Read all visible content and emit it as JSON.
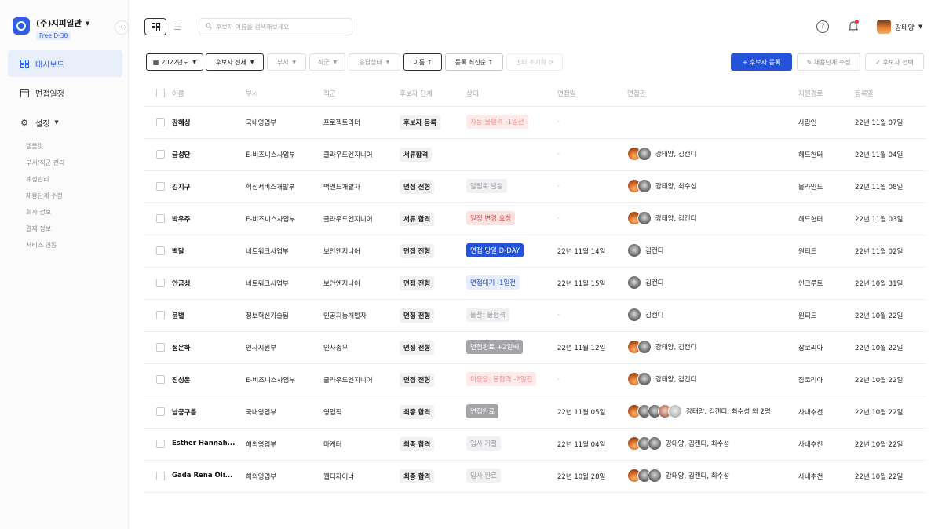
{
  "sidebar": {
    "company": "(주)지피일만",
    "plan_badge": "Free D-30",
    "nav": [
      {
        "label": "대시보드",
        "icon": "grid-icon",
        "active": true
      },
      {
        "label": "면접일정",
        "icon": "calendar-icon",
        "active": false
      },
      {
        "label": "설정",
        "icon": "gear-icon",
        "active": false
      }
    ],
    "sub_items": [
      "템플릿",
      "부서/직군 관리",
      "계정관리",
      "채용단계 수정",
      "회사 정보",
      "결제 정보",
      "서비스 연동"
    ]
  },
  "topbar": {
    "search_placeholder": "후보자 이름을 검색해보세요",
    "user_name": "강태양"
  },
  "filters": {
    "year": "2022년도",
    "candidates_all": "후보자 전체",
    "department": "부서",
    "job": "직군",
    "response_status": "응답상태",
    "name_sort": "이름 ↑",
    "registered_sort": "등록 최신순 ↑",
    "reset": "필터 초기화 ⟳"
  },
  "actions": {
    "add_candidate": "+ 후보자 등록",
    "edit_stage": "✎ 채용단계 수정",
    "select_candidate": "✓ 후보자 선택"
  },
  "table": {
    "columns": [
      "이름",
      "부서",
      "직군",
      "후보자 단계",
      "상태",
      "면접일",
      "면접관",
      "지원경로",
      "등록일"
    ],
    "rows": [
      {
        "name": "강혜성",
        "dept": "국내영업부",
        "job": "프로젝트리더",
        "stage": "후보자 등록",
        "status": "자동 불합격 -1일전",
        "status_style": "b-red",
        "date": "-",
        "avatars": [],
        "interviewers": "",
        "source": "사람인",
        "registered": "22년 11월 07일"
      },
      {
        "name": "금성단",
        "dept": "E-비즈니스사업부",
        "job": "클라우드엔지니어",
        "stage": "서류합격",
        "status": "",
        "status_style": "",
        "date": "-",
        "avatars": [
          "o",
          "g"
        ],
        "interviewers": "강태양, 김캔디",
        "source": "헤드헌터",
        "registered": "22년 11월 04일"
      },
      {
        "name": "김지구",
        "dept": "혁신서비스개발부",
        "job": "백엔드개발자",
        "stage": "면접 전형",
        "status": "알림톡 발송",
        "status_style": "b-gray",
        "date": "-",
        "avatars": [
          "o",
          "g"
        ],
        "interviewers": "강태양, 최수성",
        "source": "블라인드",
        "registered": "22년 11월 08일"
      },
      {
        "name": "박우주",
        "dept": "E-비즈니스사업부",
        "job": "클라우드엔지니어",
        "stage": "서류 합격",
        "status": "일정 변경 요청",
        "status_style": "b-red-strong",
        "date": "-",
        "avatars": [
          "o",
          "g"
        ],
        "interviewers": "강태양, 김캔디",
        "source": "헤드헌터",
        "registered": "22년 11월 03일"
      },
      {
        "name": "백달",
        "dept": "네트워크사업부",
        "job": "보안엔지니어",
        "stage": "면접 전형",
        "status": "면접 당일 D-DAY",
        "status_style": "b-blue",
        "date": "22년 11월 14일",
        "avatars": [
          "g"
        ],
        "interviewers": "김캔디",
        "source": "원티드",
        "registered": "22년 11월 02일"
      },
      {
        "name": "안금성",
        "dept": "네트워크사업부",
        "job": "보안엔지니어",
        "stage": "면접 전형",
        "status": "면접대기 -1일전",
        "status_style": "b-lightblue",
        "date": "22년 11월 15일",
        "avatars": [
          "g"
        ],
        "interviewers": "김캔디",
        "source": "인크루트",
        "registered": "22년 10월 31일"
      },
      {
        "name": "윤별",
        "dept": "정보혁신기술팀",
        "job": "인공지능개발자",
        "stage": "면접 전형",
        "status": "불참: 불합격",
        "status_style": "b-gray",
        "date": "-",
        "avatars": [
          "g"
        ],
        "interviewers": "김캔디",
        "source": "원티드",
        "registered": "22년 10월 22일"
      },
      {
        "name": "정은하",
        "dept": "인사지원부",
        "job": "인사총무",
        "stage": "면접 전형",
        "status": "면접완료 +2일째",
        "status_style": "b-darkgray",
        "date": "22년 11월 12일",
        "avatars": [
          "o",
          "g"
        ],
        "interviewers": "강태양, 김캔디",
        "source": "잡코리아",
        "registered": "22년 10월 22일"
      },
      {
        "name": "진성운",
        "dept": "E-비즈니스사업부",
        "job": "클라우드엔지니어",
        "stage": "면접 전형",
        "status": "미응답: 불합격 -2일전",
        "status_style": "b-red",
        "date": "-",
        "avatars": [
          "o",
          "g"
        ],
        "interviewers": "강태양, 김캔디",
        "source": "잡코리아",
        "registered": "22년 10월 22일"
      },
      {
        "name": "남궁구름",
        "dept": "국내영업부",
        "job": "영업직",
        "stage": "최종 합격",
        "status": "면접완료",
        "status_style": "b-darkgray",
        "date": "22년 11월 05일",
        "avatars": [
          "o",
          "g",
          "g",
          "p",
          "l"
        ],
        "interviewers": "강태양, 김캔디, 최수성 외 2명",
        "source": "사내추천",
        "registered": "22년 10월 22일"
      },
      {
        "name": "Esther Hannah...",
        "dept": "해외영업부",
        "job": "마케터",
        "stage": "최종 합격",
        "status": "입사 거절",
        "status_style": "b-gray",
        "date": "22년 11월 04일",
        "avatars": [
          "o",
          "g",
          "g"
        ],
        "interviewers": "강태양, 김캔디, 최수성",
        "source": "사내추천",
        "registered": "22년 10월 22일"
      },
      {
        "name": "Gada Rena Oli...",
        "dept": "해외영업부",
        "job": "웹디자이너",
        "stage": "최종 합격",
        "status": "입사 완료",
        "status_style": "b-gray",
        "date": "22년 10월 28일",
        "avatars": [
          "o",
          "g",
          "g"
        ],
        "interviewers": "강태양, 김캔디, 최수성",
        "source": "사내추천",
        "registered": "22년 10월 22일"
      }
    ]
  }
}
